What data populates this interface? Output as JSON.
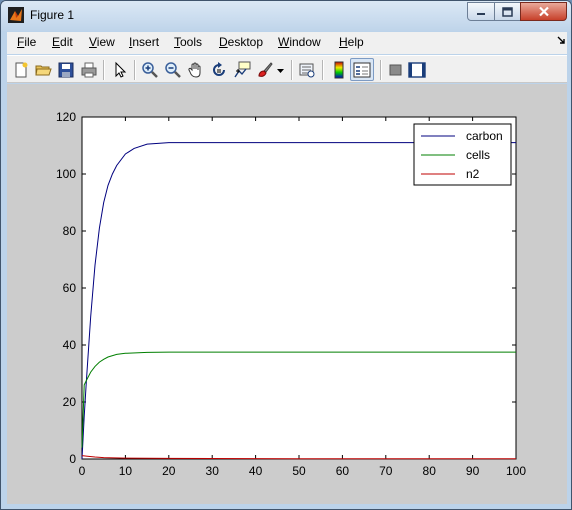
{
  "window": {
    "title": "Figure 1"
  },
  "menubar": {
    "items": [
      {
        "label": "File",
        "underline": "F",
        "rest": "ile"
      },
      {
        "label": "Edit",
        "underline": "E",
        "rest": "dit"
      },
      {
        "label": "View",
        "underline": "V",
        "rest": "iew"
      },
      {
        "label": "Insert",
        "underline": "I",
        "rest": "nsert"
      },
      {
        "label": "Tools",
        "underline": "T",
        "rest": "ools"
      },
      {
        "label": "Desktop",
        "underline": "D",
        "rest": "esktop"
      },
      {
        "label": "Window",
        "underline": "W",
        "rest": "indow"
      },
      {
        "label": "Help",
        "underline": "H",
        "rest": "elp"
      }
    ]
  },
  "toolbar": {
    "buttons": [
      "new-figure-icon",
      "open-file-icon",
      "save-icon",
      "print-icon",
      "edit-plot-arrow-icon",
      "zoom-in-icon",
      "zoom-out-icon",
      "pan-hand-icon",
      "rotate-3d-icon",
      "data-cursor-icon",
      "brush-icon",
      "brush-dropdown-icon",
      "link-plot-icon",
      "insert-colorbar-icon",
      "insert-legend-icon",
      "hide-plot-tools-icon",
      "show-plot-tools-icon"
    ]
  },
  "colors": {
    "carbon": "#00007f",
    "cells": "#007f00",
    "n2": "#bf0000"
  },
  "chart_data": {
    "type": "line",
    "xlim": [
      0,
      100
    ],
    "ylim": [
      0,
      120
    ],
    "xticks": [
      0,
      10,
      20,
      30,
      40,
      50,
      60,
      70,
      80,
      90,
      100
    ],
    "yticks": [
      0,
      20,
      40,
      60,
      80,
      100,
      120
    ],
    "grid": false,
    "legend_position": "top-right",
    "series": [
      {
        "name": "carbon",
        "x": [
          0,
          0.5,
          1,
          2,
          3,
          4,
          5,
          6,
          7,
          8,
          10,
          12,
          15,
          20,
          30,
          50,
          100
        ],
        "y": [
          0,
          15,
          27,
          50,
          68,
          81,
          90,
          96,
          100,
          103,
          107,
          109,
          110.5,
          111,
          111,
          111,
          111
        ]
      },
      {
        "name": "cells",
        "x": [
          0,
          0.5,
          1,
          2,
          3,
          4,
          5,
          6,
          8,
          10,
          15,
          20,
          30,
          50,
          100
        ],
        "y": [
          4,
          26,
          27.5,
          30.5,
          32.5,
          34,
          35,
          35.8,
          36.7,
          37.1,
          37.4,
          37.5,
          37.5,
          37.5,
          37.5
        ]
      },
      {
        "name": "n2",
        "x": [
          0,
          1,
          3,
          5,
          10,
          20,
          50,
          100
        ],
        "y": [
          1.2,
          1.0,
          0.7,
          0.5,
          0.3,
          0.2,
          0.1,
          0.1
        ]
      }
    ]
  }
}
